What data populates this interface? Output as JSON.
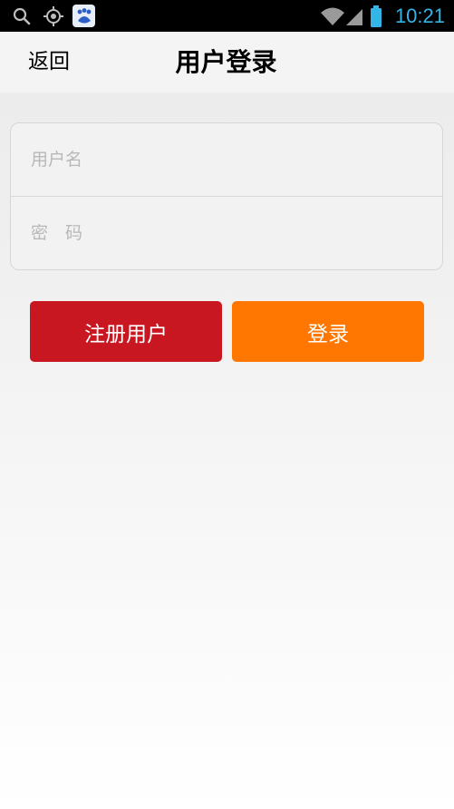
{
  "status_bar": {
    "time": "10:21",
    "icons": [
      "search-icon",
      "gps-icon",
      "baidu-app-icon",
      "wifi-icon",
      "signal-icon",
      "battery-icon"
    ],
    "time_color": "#33b5e5"
  },
  "header": {
    "back_label": "返回",
    "title": "用户登录"
  },
  "form": {
    "username_placeholder": "用户名",
    "password_placeholder": "密　码",
    "username_value": "",
    "password_value": ""
  },
  "buttons": {
    "register_label": "注册用户",
    "login_label": "登录",
    "register_color": "#c91722",
    "login_color": "#ff7700"
  }
}
